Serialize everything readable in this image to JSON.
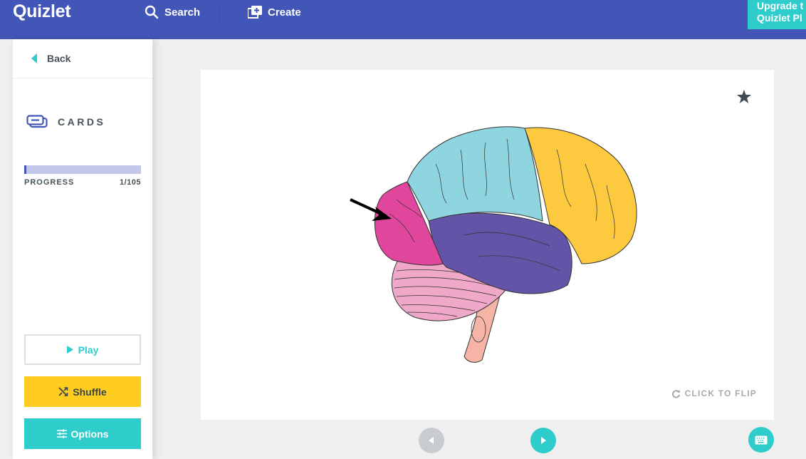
{
  "header": {
    "logo": "Quizlet",
    "nav": [
      {
        "label": "Search",
        "icon": "search-icon"
      },
      {
        "label": "Create",
        "icon": "create-icon"
      }
    ],
    "upgrade_label_line1": "Upgrade t",
    "upgrade_label_line2": "Quizlet Pl",
    "brand_color": "#4256b8",
    "accent_color": "#2fcccc"
  },
  "sidebar": {
    "back_label": "Back",
    "mode_label": "CARDS",
    "progress": {
      "label": "PROGRESS",
      "current": 1,
      "total": 105,
      "count_text": "1/105",
      "fraction": 0.0095
    },
    "buttons": {
      "play": "Play",
      "shuffle": "Shuffle",
      "options": "Options"
    },
    "shuffle_color": "#ffcd1f"
  },
  "card": {
    "flip_label": "CLICK TO FLIP",
    "image_description": "Lateral brain diagram with arrow pointing to occipital lobe",
    "lobe_colors": {
      "frontal": "#fdc93e",
      "parietal": "#8fd5e0",
      "temporal": "#6354a8",
      "occipital": "#e0479c",
      "cerebellum": "#f0a8c8",
      "brainstem": "#f6b4a6"
    },
    "starred": false
  },
  "controls": {
    "prev_label": "previous",
    "next_label": "next"
  }
}
